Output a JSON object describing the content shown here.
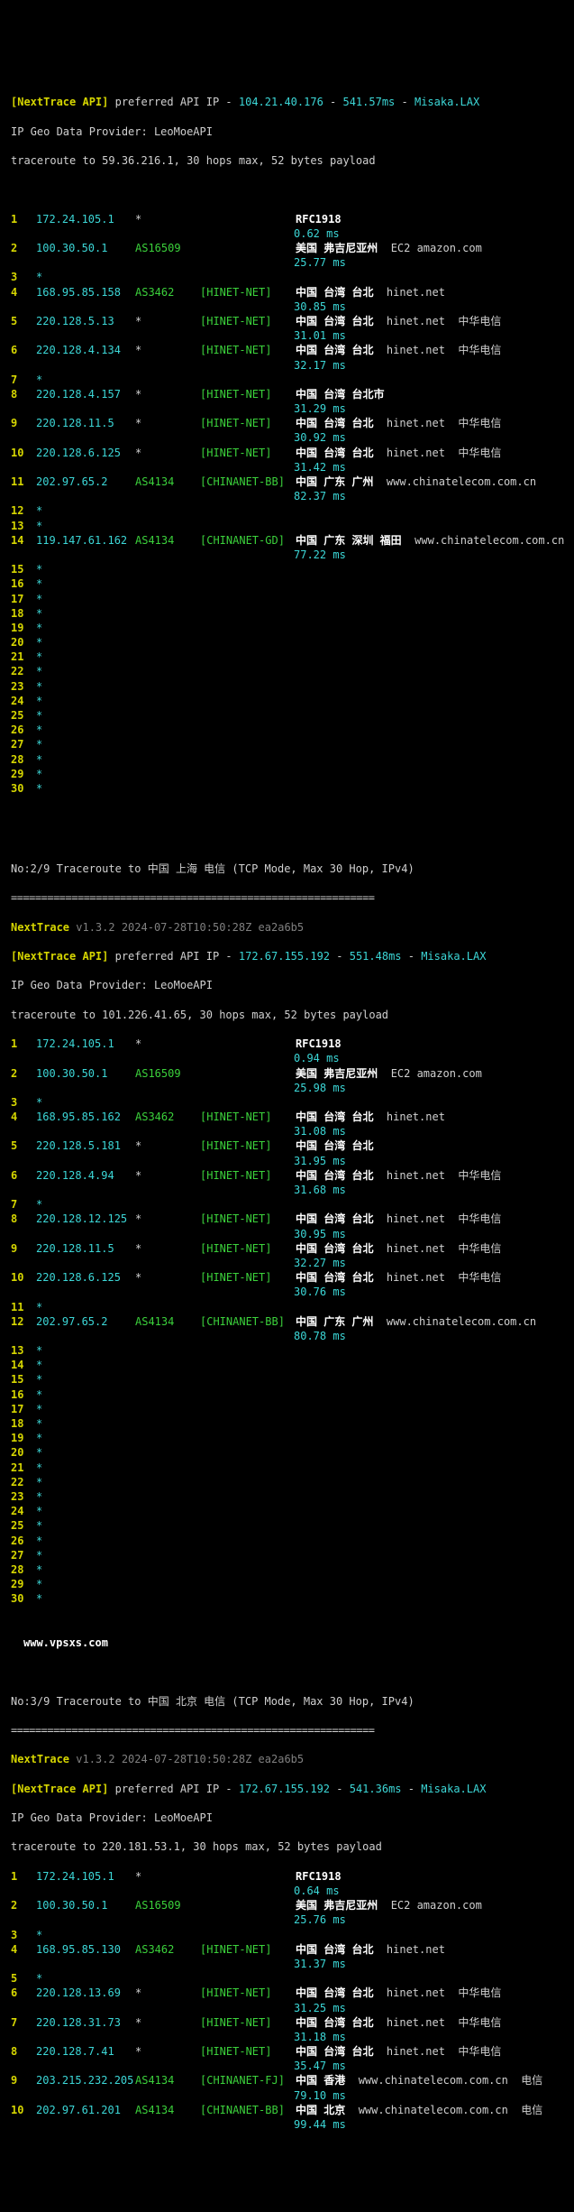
{
  "s1": {
    "api_label": "[NextTrace API]",
    "pref": " preferred API IP - ",
    "api_ip": "104.21.40.176",
    "api_rtt": "541.57ms",
    "api_node": "Misaka.LAX",
    "geo_provider": "IP Geo Data Provider: LeoMoeAPI",
    "cmd": "traceroute to 59.36.216.1, 30 hops max, 52 bytes payload"
  },
  "h1": {
    "n": "1",
    "ip": "172.24.105.1",
    "asn": "*",
    "net": "",
    "geo": "RFC1918",
    "ms": "0.62 ms"
  },
  "h2": {
    "n": "2",
    "ip": "100.30.50.1",
    "asn": "AS16509",
    "net": "",
    "geo": "美国 弗吉尼亚州",
    "dom": "EC2 amazon.com",
    "ms": "25.77 ms"
  },
  "h3": {
    "n": "3",
    "ip": "*"
  },
  "h4": {
    "n": "4",
    "ip": "168.95.85.158",
    "asn": "AS3462",
    "net": "[HINET-NET]",
    "geo": "中国 台湾 台北",
    "dom": "hinet.net",
    "ms": "30.85 ms"
  },
  "h5": {
    "n": "5",
    "ip": "220.128.5.13",
    "asn": "*",
    "net": "[HINET-NET]",
    "geo": "中国 台湾 台北",
    "dom": "hinet.net  中华电信",
    "ms": "31.01 ms"
  },
  "h6": {
    "n": "6",
    "ip": "220.128.4.134",
    "asn": "*",
    "net": "[HINET-NET]",
    "geo": "中国 台湾 台北",
    "dom": "hinet.net  中华电信",
    "ms": "32.17 ms"
  },
  "h7": {
    "n": "7",
    "ip": "*"
  },
  "h8": {
    "n": "8",
    "ip": "220.128.4.157",
    "asn": "*",
    "net": "[HINET-NET]",
    "geo": "中国 台湾 台北市",
    "ms": "31.29 ms"
  },
  "h9": {
    "n": "9",
    "ip": "220.128.11.5",
    "asn": "*",
    "net": "[HINET-NET]",
    "geo": "中国 台湾 台北",
    "dom": "hinet.net  中华电信",
    "ms": "30.92 ms"
  },
  "h10": {
    "n": "10",
    "ip": "220.128.6.125",
    "asn": "*",
    "net": "[HINET-NET]",
    "geo": "中国 台湾 台北",
    "dom": "hinet.net  中华电信",
    "ms": "31.42 ms"
  },
  "h11": {
    "n": "11",
    "ip": "202.97.65.2",
    "asn": "AS4134",
    "net": "[CHINANET-BB]",
    "geo": "中国 广东 广州",
    "dom": "www.chinatelecom.com.cn",
    "ms": "82.37 ms"
  },
  "h12": {
    "n": "12",
    "ip": "*"
  },
  "h13": {
    "n": "13",
    "ip": "*"
  },
  "h14": {
    "n": "14",
    "ip": "119.147.61.162",
    "asn": "AS4134",
    "net": "[CHINANET-GD]",
    "geo": "中国 广东 深圳 福田",
    "dom": "www.chinatelecom.com.cn",
    "ms": "77.22 ms"
  },
  "h15": {
    "n": "15",
    "ip": "*"
  },
  "h16": {
    "n": "16",
    "ip": "*"
  },
  "h17": {
    "n": "17",
    "ip": "*"
  },
  "h18": {
    "n": "18",
    "ip": "*"
  },
  "h19": {
    "n": "19",
    "ip": "*"
  },
  "h20": {
    "n": "20",
    "ip": "*"
  },
  "h21": {
    "n": "21",
    "ip": "*"
  },
  "h22": {
    "n": "22",
    "ip": "*"
  },
  "h23": {
    "n": "23",
    "ip": "*"
  },
  "h24": {
    "n": "24",
    "ip": "*"
  },
  "h25": {
    "n": "25",
    "ip": "*"
  },
  "h26": {
    "n": "26",
    "ip": "*"
  },
  "h27": {
    "n": "27",
    "ip": "*"
  },
  "h28": {
    "n": "28",
    "ip": "*"
  },
  "h29": {
    "n": "29",
    "ip": "*"
  },
  "h30": {
    "n": "30",
    "ip": "*"
  },
  "s2": {
    "title": "No:2/9 Traceroute to 中国 上海 电信 (TCP Mode, Max 30 Hop, IPv4)",
    "sep": "============================================================",
    "ver_label": "NextTrace",
    "ver_grey": " v1.3.2 2024-07-28T10:50:28Z ea2a6b5",
    "api_label": "[NextTrace API]",
    "pref": " preferred API IP - ",
    "api_ip": "172.67.155.192",
    "api_rtt": "551.48ms",
    "api_node": "Misaka.LAX",
    "geo_provider": "IP Geo Data Provider: LeoMoeAPI",
    "cmd": "traceroute to 101.226.41.65, 30 hops max, 52 bytes payload"
  },
  "b1": {
    "n": "1",
    "ip": "172.24.105.1",
    "asn": "*",
    "geo": "RFC1918",
    "ms": "0.94 ms"
  },
  "b2": {
    "n": "2",
    "ip": "100.30.50.1",
    "asn": "AS16509",
    "geo": "美国 弗吉尼亚州",
    "dom": "EC2 amazon.com",
    "ms": "25.98 ms"
  },
  "b3": {
    "n": "3",
    "ip": "*"
  },
  "b4": {
    "n": "4",
    "ip": "168.95.85.162",
    "asn": "AS3462",
    "net": "[HINET-NET]",
    "geo": "中国 台湾 台北",
    "dom": "hinet.net",
    "ms": "31.08 ms"
  },
  "b5": {
    "n": "5",
    "ip": "220.128.5.181",
    "asn": "*",
    "net": "[HINET-NET]",
    "geo": "中国 台湾 台北",
    "ms": "31.95 ms"
  },
  "b6": {
    "n": "6",
    "ip": "220.128.4.94",
    "asn": "*",
    "net": "[HINET-NET]",
    "geo": "中国 台湾 台北",
    "dom": "hinet.net  中华电信",
    "ms": "31.68 ms"
  },
  "b7": {
    "n": "7",
    "ip": "*"
  },
  "b8": {
    "n": "8",
    "ip": "220.128.12.125",
    "asn": "*",
    "net": "[HINET-NET]",
    "geo": "中国 台湾 台北",
    "dom": "hinet.net  中华电信",
    "ms": "30.95 ms"
  },
  "b9": {
    "n": "9",
    "ip": "220.128.11.5",
    "asn": "*",
    "net": "[HINET-NET]",
    "geo": "中国 台湾 台北",
    "dom": "hinet.net  中华电信",
    "ms": "32.27 ms"
  },
  "b10": {
    "n": "10",
    "ip": "220.128.6.125",
    "asn": "*",
    "net": "[HINET-NET]",
    "geo": "中国 台湾 台北",
    "dom": "hinet.net  中华电信",
    "ms": "30.76 ms"
  },
  "b11": {
    "n": "11",
    "ip": "*"
  },
  "b12": {
    "n": "12",
    "ip": "202.97.65.2",
    "asn": "AS4134",
    "net": "[CHINANET-BB]",
    "geo": "中国 广东 广州",
    "dom": "www.chinatelecom.com.cn",
    "ms": "80.78 ms"
  },
  "b13": {
    "n": "13",
    "ip": "*"
  },
  "b14": {
    "n": "14",
    "ip": "*"
  },
  "b15": {
    "n": "15",
    "ip": "*"
  },
  "b16": {
    "n": "16",
    "ip": "*"
  },
  "b17": {
    "n": "17",
    "ip": "*"
  },
  "b18": {
    "n": "18",
    "ip": "*"
  },
  "b19": {
    "n": "19",
    "ip": "*"
  },
  "b20": {
    "n": "20",
    "ip": "*"
  },
  "b21": {
    "n": "21",
    "ip": "*"
  },
  "b22": {
    "n": "22",
    "ip": "*"
  },
  "b23": {
    "n": "23",
    "ip": "*"
  },
  "b24": {
    "n": "24",
    "ip": "*"
  },
  "b25": {
    "n": "25",
    "ip": "*"
  },
  "b26": {
    "n": "26",
    "ip": "*"
  },
  "b27": {
    "n": "27",
    "ip": "*"
  },
  "b28": {
    "n": "28",
    "ip": "*"
  },
  "b29": {
    "n": "29",
    "ip": "*"
  },
  "b30": {
    "n": "30",
    "ip": "*"
  },
  "watermark": "www.vpsxs.com",
  "s3": {
    "title": "No:3/9 Traceroute to 中国 北京 电信 (TCP Mode, Max 30 Hop, IPv4)",
    "sep": "============================================================",
    "ver_label": "NextTrace",
    "ver_grey": " v1.3.2 2024-07-28T10:50:28Z ea2a6b5",
    "api_label": "[NextTrace API]",
    "pref": " preferred API IP - ",
    "api_ip": "172.67.155.192",
    "api_rtt": "541.36ms",
    "api_node": "Misaka.LAX",
    "geo_provider": "IP Geo Data Provider: LeoMoeAPI",
    "cmd": "traceroute to 220.181.53.1, 30 hops max, 52 bytes payload"
  },
  "c1": {
    "n": "1",
    "ip": "172.24.105.1",
    "asn": "*",
    "geo": "RFC1918",
    "ms": "0.64 ms"
  },
  "c2": {
    "n": "2",
    "ip": "100.30.50.1",
    "asn": "AS16509",
    "geo": "美国 弗吉尼亚州",
    "dom": "EC2 amazon.com",
    "ms": "25.76 ms"
  },
  "c3": {
    "n": "3",
    "ip": "*"
  },
  "c4": {
    "n": "4",
    "ip": "168.95.85.130",
    "asn": "AS3462",
    "net": "[HINET-NET]",
    "geo": "中国 台湾 台北",
    "dom": "hinet.net",
    "ms": "31.37 ms"
  },
  "c5": {
    "n": "5",
    "ip": "*"
  },
  "c6": {
    "n": "6",
    "ip": "220.128.13.69",
    "asn": "*",
    "net": "[HINET-NET]",
    "geo": "中国 台湾 台北",
    "dom": "hinet.net  中华电信",
    "ms": "31.25 ms"
  },
  "c7": {
    "n": "7",
    "ip": "220.128.31.73",
    "asn": "*",
    "net": "[HINET-NET]",
    "geo": "中国 台湾 台北",
    "dom": "hinet.net  中华电信",
    "ms": "31.18 ms"
  },
  "c8": {
    "n": "8",
    "ip": "220.128.7.41",
    "asn": "*",
    "net": "[HINET-NET]",
    "geo": "中国 台湾 台北",
    "dom": "hinet.net  中华电信",
    "ms": "35.47 ms"
  },
  "c9": {
    "n": "9",
    "ip": "203.215.232.205",
    "asn": "AS4134",
    "net": "[CHINANET-FJ]",
    "geo": "中国 香港",
    "dom": "www.chinatelecom.com.cn  电信",
    "ms": "79.10 ms"
  },
  "c10": {
    "n": "10",
    "ip": "202.97.61.201",
    "asn": "AS4134",
    "net": "[CHINANET-BB]",
    "geo": "中国 北京",
    "dom": "www.chinatelecom.com.cn  电信",
    "ms": "99.44 ms"
  }
}
